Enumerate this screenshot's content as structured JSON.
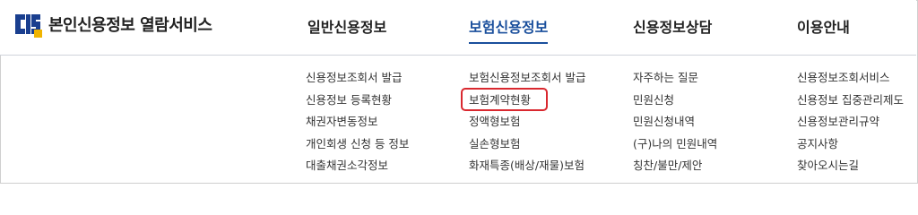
{
  "brand": {
    "logo_icon": "cis-logo-icon",
    "title": "본인신용정보 열람서비스"
  },
  "colors": {
    "accent": "#1a4f9c",
    "logo_blue": "#1a3f8f",
    "logo_yellow": "#f0b400",
    "highlight": "#d9282f",
    "divider": "#cfd3da"
  },
  "nav": {
    "menus": [
      {
        "label": "일반신용정보",
        "items": [
          "신용정보조회서 발급",
          "신용정보 등록현황",
          "채권자변동정보",
          "개인회생 신청 등 정보",
          "대출채권소각정보"
        ]
      },
      {
        "label": "보험신용정보",
        "active": true,
        "items": [
          "보험신용정보조회서 발급",
          "보험계약현황",
          "정액형보험",
          "실손형보험",
          "화재특종(배상/재물)보험"
        ],
        "highlighted_item": "보험계약현황"
      },
      {
        "label": "신용정보상담",
        "items": [
          "자주하는 질문",
          "민원신청",
          "민원신청내역",
          "(구)나의 민원내역",
          "칭찬/불만/제안"
        ]
      },
      {
        "label": "이용안내",
        "items": [
          "신용정보조회서비스",
          "신용정보 집중관리제도",
          "신용정보관리규약",
          "공지사항",
          "찾아오시는길"
        ]
      }
    ]
  }
}
